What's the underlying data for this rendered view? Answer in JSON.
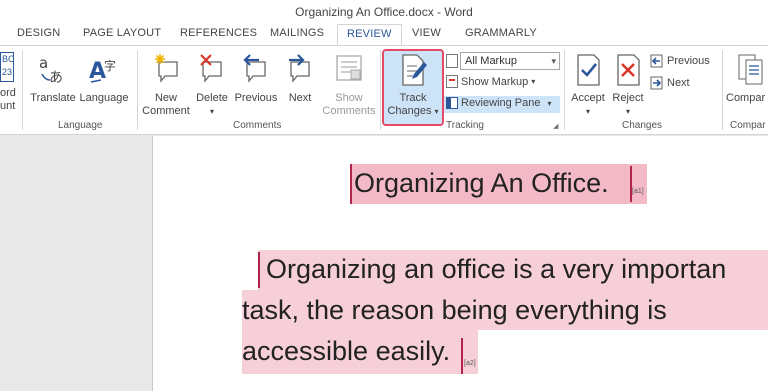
{
  "window": {
    "title": "Organizing An Office.docx - Word"
  },
  "tabs": [
    "DESIGN",
    "PAGE LAYOUT",
    "REFERENCES",
    "MAILINGS",
    "REVIEW",
    "VIEW",
    "GRAMMARLY"
  ],
  "ribbon": {
    "partial_left": {
      "line1": "BC",
      "line2": "23",
      "label1": "ord",
      "label2": "unt"
    },
    "language": {
      "translate": "Translate",
      "language": "Language",
      "group": "Language"
    },
    "comments": {
      "new_1": "New",
      "new_2": "Comment",
      "delete": "Delete",
      "previous": "Previous",
      "next": "Next",
      "show_1": "Show",
      "show_2": "Comments",
      "group": "Comments"
    },
    "tracking": {
      "track_1": "Track",
      "track_2": "Changes",
      "markup_select": "All Markup",
      "show_markup": "Show Markup",
      "reviewing_pane": "Reviewing Pane",
      "group": "Tracking"
    },
    "changes": {
      "accept": "Accept",
      "reject": "Reject",
      "previous": "Previous",
      "next": "Next",
      "group": "Changes"
    },
    "compare": {
      "label": "Compar",
      "group": "Compar"
    }
  },
  "document": {
    "heading": "Organizing An Office.",
    "heading_comment": "[a1]",
    "para_line1": "Organizing an office is a very importan",
    "para_line2": "task, the reason being everything is",
    "para_line3": "accessible easily.",
    "para_comment": "[a2]"
  },
  "colors": {
    "accent": "#2b579a",
    "highlight_box": "#e64a67",
    "tracked": "#f4b9c7"
  }
}
